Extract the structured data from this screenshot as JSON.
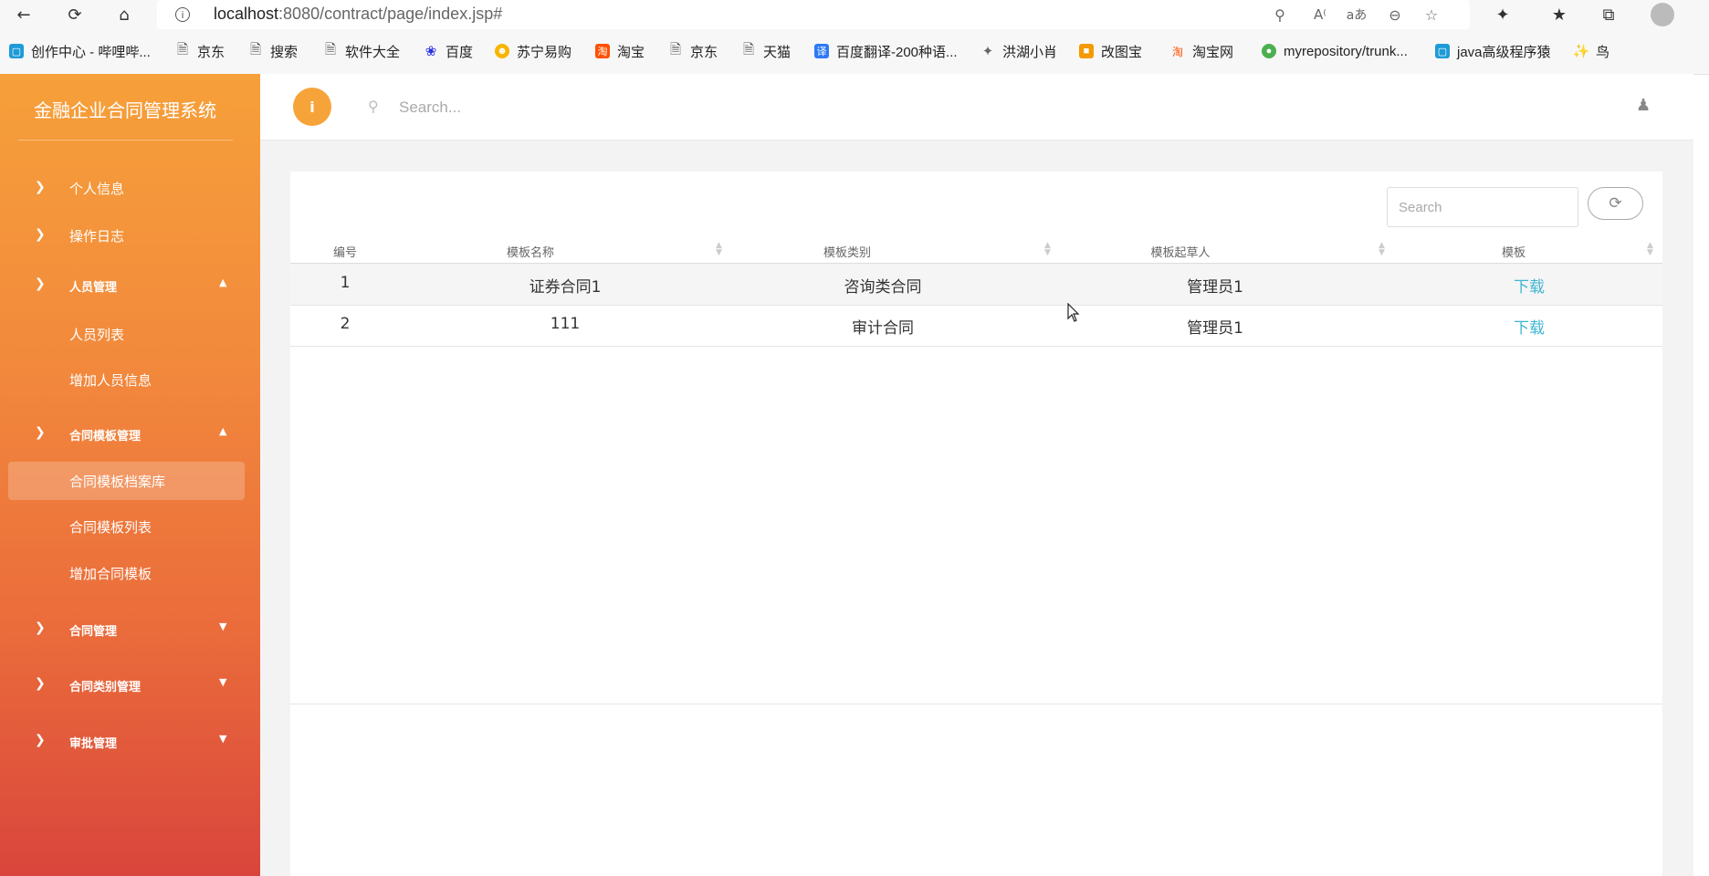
{
  "browser": {
    "url_host": "localhost",
    "url_rest": ":8080/contract/page/index.jsp#",
    "bookmarks": [
      {
        "label": "创作中心 - 哔哩哔...",
        "icon": "bilibili-icon",
        "color": "#1e9bd7"
      },
      {
        "label": "京东",
        "icon": "page-icon",
        "color": "#555"
      },
      {
        "label": "搜索",
        "icon": "page-icon",
        "color": "#555"
      },
      {
        "label": "软件大全",
        "icon": "page-icon",
        "color": "#555"
      },
      {
        "label": "百度",
        "icon": "baidu-icon",
        "color": "#2932e1"
      },
      {
        "label": "苏宁易购",
        "icon": "suning-icon",
        "color": "#f7b500"
      },
      {
        "label": "淘宝",
        "icon": "taobao-icon",
        "color": "#ff5000"
      },
      {
        "label": "京东",
        "icon": "page-icon",
        "color": "#555"
      },
      {
        "label": "天猫",
        "icon": "page-icon",
        "color": "#555"
      },
      {
        "label": "百度翻译-200种语...",
        "icon": "translate-icon",
        "color": "#2d7af6"
      },
      {
        "label": "洪湖小肖",
        "icon": "bird-icon",
        "color": "#666"
      },
      {
        "label": "改图宝",
        "icon": "gaitubao-icon",
        "color": "#f59a00"
      },
      {
        "label": "淘宝网",
        "icon": "taobao-icon",
        "color": "#ff5000"
      },
      {
        "label": "myrepository/trunk...",
        "icon": "chrome-icon",
        "color": "#4caf50"
      },
      {
        "label": "java高级程序猿",
        "icon": "bilibili-icon",
        "color": "#1e9bd7"
      },
      {
        "label": "鸟",
        "icon": "bird-red-icon",
        "color": "#e53935"
      }
    ]
  },
  "app": {
    "brand": "金融企业合同管理系统",
    "search_placeholder": "Search...",
    "info_glyph": "i",
    "nav": {
      "personal_info": "个人信息",
      "operation_log": "操作日志",
      "staff_mgmt": "人员管理",
      "staff_list": "人员列表",
      "add_staff": "增加人员信息",
      "template_mgmt": "合同模板管理",
      "template_archive": "合同模板档案库",
      "template_list": "合同模板列表",
      "add_template": "增加合同模板",
      "contract_mgmt": "合同管理",
      "contract_type_mgmt": "合同类别管理",
      "approval_mgmt": "审批管理"
    }
  },
  "table": {
    "search_placeholder": "Search",
    "headers": [
      "编号",
      "模板名称",
      "模板类别",
      "模板起草人",
      "模板"
    ],
    "rows": [
      {
        "id": "1",
        "name": "证券合同1",
        "category": "咨询类合同",
        "drafter": "管理员1",
        "action": "下载"
      },
      {
        "id": "2",
        "name": "111",
        "category": "审计合同",
        "drafter": "管理员1",
        "action": "下载"
      }
    ]
  },
  "colors": {
    "accent_orange": "#f6a43a",
    "link_blue": "#3fb6d2"
  }
}
